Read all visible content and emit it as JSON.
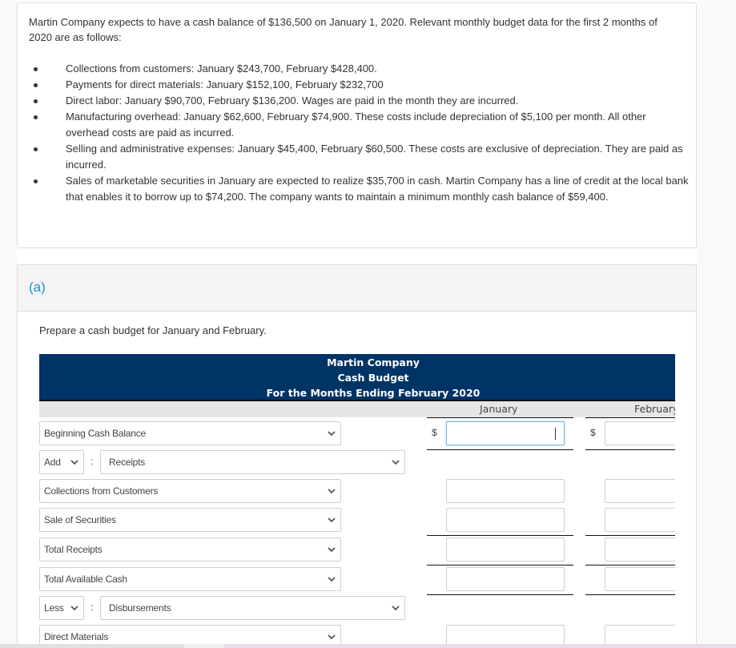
{
  "problem": {
    "intro": "Martin Company expects to have a cash balance of $136,500 on January 1, 2020. Relevant monthly budget data for the first 2 months of 2020 are as follows:",
    "bullets": [
      "Collections from customers: January $243,700, February $428,400.",
      "Payments for direct materials: January $152,100, February $232,700",
      "Direct labor: January $90,700, February $136,200. Wages are paid in the month they are incurred.",
      "Manufacturing overhead: January $62,600, February $74,900. These costs include depreciation of $5,100 per month. All other overhead costs are paid as incurred.",
      "Selling and administrative expenses: January $45,400, February $60,500. These costs are exclusive of depreciation. They are paid as incurred.",
      "Sales of marketable securities in January are expected to realize $35,700 in cash. Martin Company has a line of credit at the local bank that enables it to borrow up to $74,200. The company wants to maintain a minimum monthly cash balance of $59,400."
    ]
  },
  "part": {
    "label": "(a)",
    "instruction": "Prepare a cash budget for January and February."
  },
  "budget": {
    "title_lines": [
      "Martin Company",
      "Cash Budget",
      "For the Months Ending February 2020"
    ],
    "columns": [
      "January",
      "February"
    ],
    "currency_symbol": "$",
    "rows": [
      {
        "type": "select",
        "label": "Beginning Cash Balance",
        "jan": "",
        "feb": ""
      },
      {
        "type": "section",
        "operator": "Add",
        "label": "Receipts"
      },
      {
        "type": "select",
        "label": "Collections from Customers",
        "jan": "",
        "feb": ""
      },
      {
        "type": "select",
        "label": "Sale of Securities",
        "jan": "",
        "feb": ""
      },
      {
        "type": "select",
        "label": "Total Receipts",
        "jan": "",
        "feb": ""
      },
      {
        "type": "select",
        "label": "Total Available Cash",
        "jan": "",
        "feb": ""
      },
      {
        "type": "section",
        "operator": "Less",
        "label": "Disbursements"
      },
      {
        "type": "select",
        "label": "Direct Materials",
        "jan": "",
        "feb": ""
      }
    ]
  },
  "colors": {
    "header_bg": "#003366",
    "part_label": "#1a8fdd",
    "focus_border": "#7fb3e0"
  }
}
